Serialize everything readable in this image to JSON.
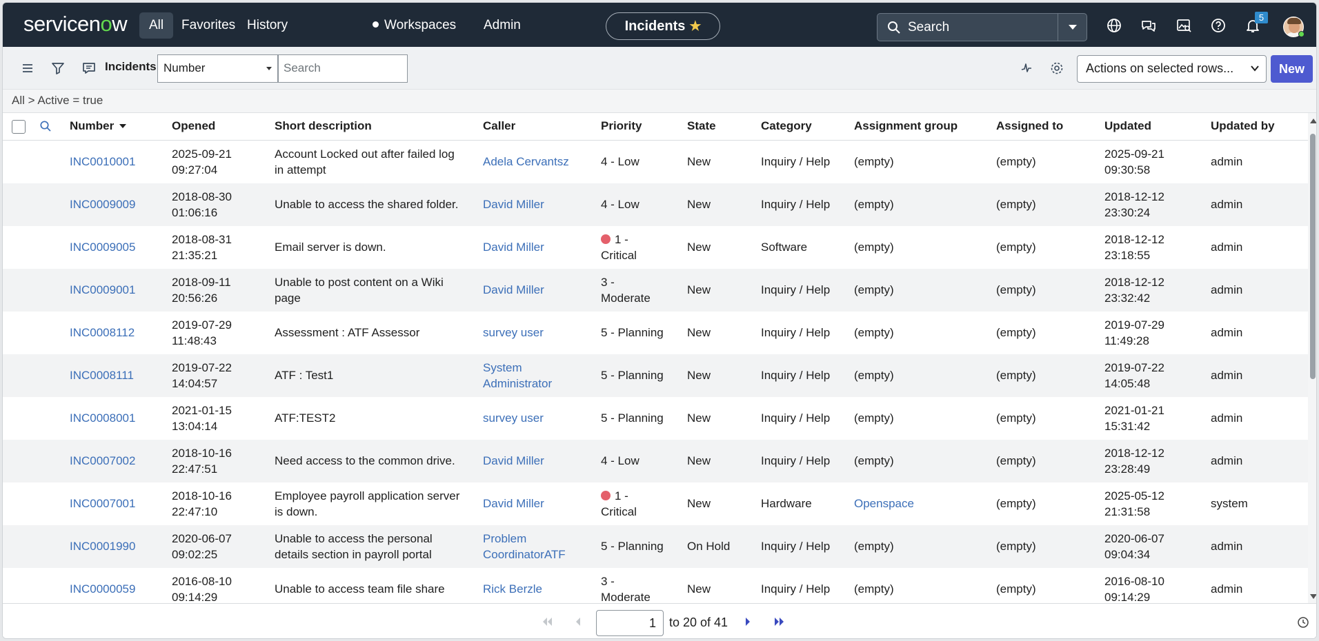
{
  "brand": {
    "logo_text_a": "servicen",
    "logo_text_o": "o",
    "logo_text_b": "w"
  },
  "topnav": {
    "items": [
      {
        "label": "All",
        "active": true
      },
      {
        "label": "Favorites"
      },
      {
        "label": "History"
      },
      {
        "label": "Workspaces"
      },
      {
        "label": "Admin"
      }
    ],
    "context_pill": "Incidents",
    "search_label": "Search",
    "notification_count": "5",
    "icons": [
      "globe-icon",
      "chat-icon",
      "image-search-icon",
      "help-icon",
      "bell-icon"
    ]
  },
  "toolbar": {
    "title": "Incidents",
    "field_select": "Number",
    "search_placeholder": "Search",
    "actions_select": "Actions on selected rows...",
    "new_label": "New"
  },
  "breadcrumb": "All > Active = true",
  "table": {
    "columns": [
      "Number",
      "Opened",
      "Short description",
      "Caller",
      "Priority",
      "State",
      "Category",
      "Assignment group",
      "Assigned to",
      "Updated",
      "Updated by"
    ],
    "rows": [
      {
        "number": "INC0010001",
        "opened": [
          "2025-09-21",
          "09:27:04"
        ],
        "desc": [
          "Account Locked out after failed log",
          "in attempt"
        ],
        "caller": [
          "Adela Cervantsz"
        ],
        "priority": [
          "4 - Low"
        ],
        "critical": false,
        "state": "New",
        "category": "Inquiry / Help",
        "group": "(empty)",
        "group_link": false,
        "assigned": "(empty)",
        "updated": [
          "2025-09-21",
          "09:30:58"
        ],
        "updated_by": "admin"
      },
      {
        "number": "INC0009009",
        "opened": [
          "2018-08-30",
          "01:06:16"
        ],
        "desc": [
          "Unable to access the shared folder."
        ],
        "caller": [
          "David Miller"
        ],
        "priority": [
          "4 - Low"
        ],
        "critical": false,
        "state": "New",
        "category": "Inquiry / Help",
        "group": "(empty)",
        "group_link": false,
        "assigned": "(empty)",
        "updated": [
          "2018-12-12",
          "23:30:24"
        ],
        "updated_by": "admin"
      },
      {
        "number": "INC0009005",
        "opened": [
          "2018-08-31",
          "21:35:21"
        ],
        "desc": [
          "Email server is down."
        ],
        "caller": [
          "David Miller"
        ],
        "priority": [
          "1 -",
          "Critical"
        ],
        "critical": true,
        "state": "New",
        "category": "Software",
        "group": "(empty)",
        "group_link": false,
        "assigned": "(empty)",
        "updated": [
          "2018-12-12",
          "23:18:55"
        ],
        "updated_by": "admin"
      },
      {
        "number": "INC0009001",
        "opened": [
          "2018-09-11",
          "20:56:26"
        ],
        "desc": [
          "Unable to post content on a Wiki",
          "page"
        ],
        "caller": [
          "David Miller"
        ],
        "priority": [
          "3 -",
          "Moderate"
        ],
        "critical": false,
        "state": "New",
        "category": "Inquiry / Help",
        "group": "(empty)",
        "group_link": false,
        "assigned": "(empty)",
        "updated": [
          "2018-12-12",
          "23:32:42"
        ],
        "updated_by": "admin"
      },
      {
        "number": "INC0008112",
        "opened": [
          "2019-07-29",
          "11:48:43"
        ],
        "desc": [
          "Assessment : ATF Assessor"
        ],
        "caller": [
          "survey user"
        ],
        "priority": [
          "5 - Planning"
        ],
        "critical": false,
        "state": "New",
        "category": "Inquiry / Help",
        "group": "(empty)",
        "group_link": false,
        "assigned": "(empty)",
        "updated": [
          "2019-07-29",
          "11:49:28"
        ],
        "updated_by": "admin"
      },
      {
        "number": "INC0008111",
        "opened": [
          "2019-07-22",
          "14:04:57"
        ],
        "desc": [
          "ATF : Test1"
        ],
        "caller": [
          "System",
          "Administrator"
        ],
        "priority": [
          "5 - Planning"
        ],
        "critical": false,
        "state": "New",
        "category": "Inquiry / Help",
        "group": "(empty)",
        "group_link": false,
        "assigned": "(empty)",
        "updated": [
          "2019-07-22",
          "14:05:48"
        ],
        "updated_by": "admin"
      },
      {
        "number": "INC0008001",
        "opened": [
          "2021-01-15",
          "13:04:14"
        ],
        "desc": [
          "ATF:TEST2"
        ],
        "caller": [
          "survey user"
        ],
        "priority": [
          "5 - Planning"
        ],
        "critical": false,
        "state": "New",
        "category": "Inquiry / Help",
        "group": "(empty)",
        "group_link": false,
        "assigned": "(empty)",
        "updated": [
          "2021-01-21",
          "15:31:42"
        ],
        "updated_by": "admin"
      },
      {
        "number": "INC0007002",
        "opened": [
          "2018-10-16",
          "22:47:51"
        ],
        "desc": [
          "Need access to the common drive."
        ],
        "caller": [
          "David Miller"
        ],
        "priority": [
          "4 - Low"
        ],
        "critical": false,
        "state": "New",
        "category": "Inquiry / Help",
        "group": "(empty)",
        "group_link": false,
        "assigned": "(empty)",
        "updated": [
          "2018-12-12",
          "23:28:49"
        ],
        "updated_by": "admin"
      },
      {
        "number": "INC0007001",
        "opened": [
          "2018-10-16",
          "22:47:10"
        ],
        "desc": [
          "Employee payroll application server",
          "is down."
        ],
        "caller": [
          "David Miller"
        ],
        "priority": [
          "1 -",
          "Critical"
        ],
        "critical": true,
        "state": "New",
        "category": "Hardware",
        "group": "Openspace",
        "group_link": true,
        "assigned": "(empty)",
        "updated": [
          "2025-05-12",
          "21:31:58"
        ],
        "updated_by": "system"
      },
      {
        "number": "INC0001990",
        "opened": [
          "2020-06-07",
          "09:02:25"
        ],
        "desc": [
          "Unable to access the personal",
          "details section in payroll portal"
        ],
        "caller": [
          "Problem",
          "CoordinatorATF"
        ],
        "priority": [
          "5 - Planning"
        ],
        "critical": false,
        "state": "On Hold",
        "category": "Inquiry / Help",
        "group": "(empty)",
        "group_link": false,
        "assigned": "(empty)",
        "updated": [
          "2020-06-07",
          "09:04:34"
        ],
        "updated_by": "admin"
      },
      {
        "number": "INC0000059",
        "opened": [
          "2016-08-10",
          "09:14:29"
        ],
        "desc": [
          "Unable to access team file share"
        ],
        "caller": [
          "Rick Berzle"
        ],
        "priority": [
          "3 -",
          "Moderate"
        ],
        "critical": false,
        "state": "New",
        "category": "Inquiry / Help",
        "group": "(empty)",
        "group_link": false,
        "assigned": "(empty)",
        "updated": [
          "2016-08-10",
          "09:14:29"
        ],
        "updated_by": "admin"
      }
    ]
  },
  "pager": {
    "page_value": "1",
    "range_text": "to 20 of 41"
  },
  "colors": {
    "topnav_bg": "#1f2a37",
    "accent": "#4e5ad0",
    "link": "#3c6fb8",
    "critical_dot": "#e4606b",
    "logo_green": "#62d84e"
  }
}
